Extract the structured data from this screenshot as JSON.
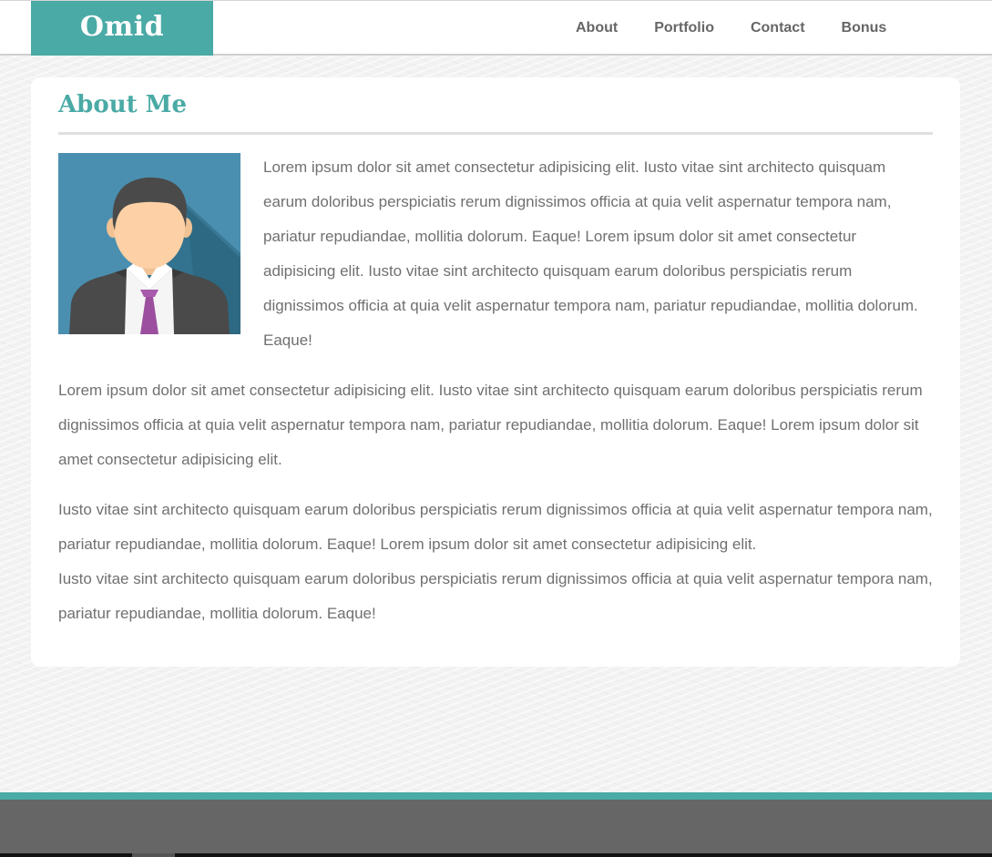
{
  "header": {
    "brand": "Omid",
    "nav": [
      {
        "label": "About"
      },
      {
        "label": "Portfolio"
      },
      {
        "label": "Contact"
      },
      {
        "label": "Bonus"
      }
    ]
  },
  "main": {
    "title": "About Me",
    "avatar_icon": "businessman-avatar-icon",
    "paragraphs": [
      "Lorem ipsum dolor sit amet consectetur adipisicing elit. Iusto vitae sint architecto quisquam earum doloribus perspiciatis rerum dignissimos officia at quia velit aspernatur tempora nam, pariatur repudiandae, mollitia dolorum. Eaque! Lorem ipsum dolor sit amet consectetur adipisicing elit. Iusto vitae sint architecto quisquam earum doloribus perspiciatis rerum dignissimos officia at quia velit aspernatur tempora nam, pariatur repudiandae, mollitia dolorum. Eaque!",
      "Lorem ipsum dolor sit amet consectetur adipisicing elit. Iusto vitae sint architecto quisquam earum doloribus perspiciatis rerum dignissimos officia at quia velit aspernatur tempora nam, pariatur repudiandae, mollitia dolorum. Eaque! Lorem ipsum dolor sit amet consectetur adipisicing elit.",
      "Iusto vitae sint architecto quisquam earum doloribus perspiciatis rerum dignissimos officia at quia velit aspernatur tempora nam, pariatur repudiandae, mollitia dolorum. Eaque! Lorem ipsum dolor sit amet consectetur adipisicing elit.",
      "Iusto vitae sint architecto quisquam earum doloribus perspiciatis rerum dignissimos officia at quia velit aspernatur tempora nam, pariatur repudiandae, mollitia dolorum. Eaque!"
    ]
  },
  "colors": {
    "accent": "#4aaaa5",
    "text": "#707070",
    "nav_text": "#666666",
    "footer": "#666666"
  }
}
